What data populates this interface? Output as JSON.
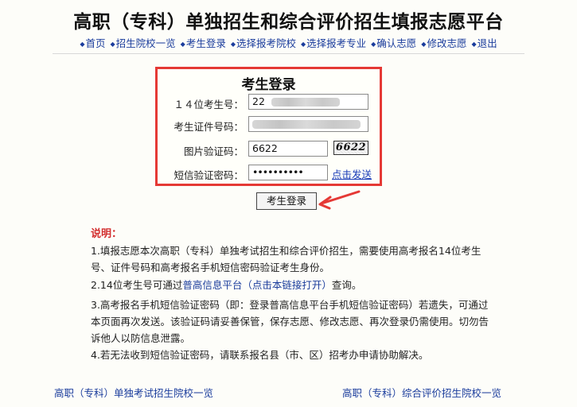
{
  "header": {
    "title": "高职（专科）单独招生和综合评价招生填报志愿平台"
  },
  "nav": {
    "items": [
      {
        "label": "首页"
      },
      {
        "label": "招生院校一览"
      },
      {
        "label": "考生登录"
      },
      {
        "label": "选择报考院校"
      },
      {
        "label": "选择报考专业"
      },
      {
        "label": "确认志愿"
      },
      {
        "label": "修改志愿"
      },
      {
        "label": "退出"
      }
    ],
    "bullet": "◆"
  },
  "login": {
    "title": "考生登录",
    "exam_no_label": "１４位考生号：",
    "exam_no_value": "22",
    "id_no_label": "考生证件号码：",
    "id_no_value": "",
    "captcha_label": "图片验证码：",
    "captcha_value": "6622",
    "captcha_image_text": "6622",
    "sms_label": "短信验证密码：",
    "sms_value": "••••••••••",
    "sms_send_link": "点击发送",
    "submit_label": "考生登录",
    "highlight_color": "#e53935"
  },
  "notes": {
    "heading": "说明：",
    "item1": "1.填报志愿本次高职（专科）单独考试招生和综合评价招生，需要使用高考报名14位考生号、证件号码和高考报名手机短信密码验证考生身份。",
    "item2_prefix": "2.14位考生号可通过",
    "item2_link": "普高信息平台（点击本链接打开）",
    "item2_suffix": "查询。",
    "item3": "3.高考报名手机短信验证密码（即：登录普高信息平台手机短信验证密码）若遗失，可通过本页面再次发送。该验证码请妥善保管，保存志愿、修改志愿、再次登录仍需使用。切勿告诉他人以防信息泄露。",
    "item4": "4.若无法收到短信验证密码，请联系报名县（市、区）招考办申请协助解决。"
  },
  "footer": {
    "left_link": "高职（专科）单独考试招生院校一览",
    "right_link": "高职（专科）综合评价招生院校一览"
  }
}
